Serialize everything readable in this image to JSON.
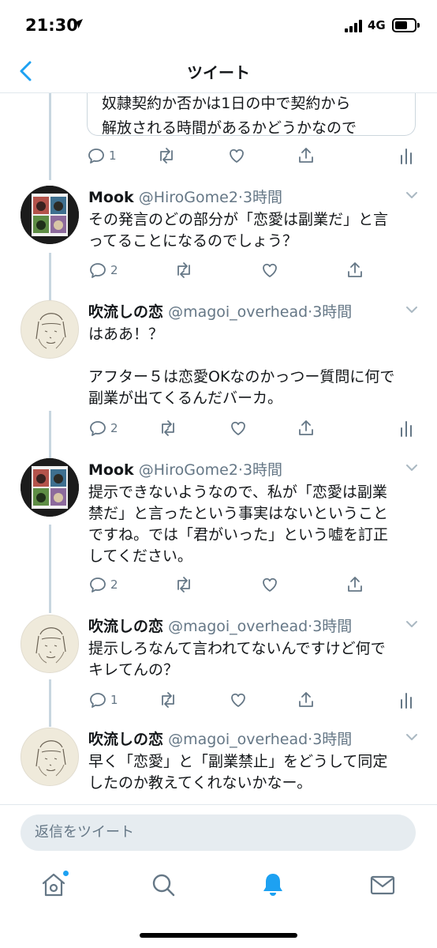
{
  "status_bar": {
    "time": "21:30",
    "network": "4G"
  },
  "nav": {
    "title": "ツイート"
  },
  "quoted_tweet": {
    "text": "奴隷契約か否かは1日の中で契約から\n解放される時間があるかどうかなので"
  },
  "first_actions": {
    "reply_count": "1"
  },
  "tweets": [
    {
      "name": "Mook",
      "handle": "@HiroGome2",
      "time": "·3時間",
      "text": "その発言のどの部分が「恋愛は副業だ」と言\nってることになるのでしょう？",
      "reply_count": "2"
    },
    {
      "name": "吹流しの恋",
      "handle": "@magoi_overhead",
      "time": "·3時間",
      "text": "はああ！？\n\nアフター５は恋愛OKなのかっつー質問に何で\n副業が出てくるんだバーカ。",
      "reply_count": "2"
    },
    {
      "name": "Mook",
      "handle": "@HiroGome2",
      "time": "·3時間",
      "text": "提示できないようなので、私が「恋愛は副業\n禁だ」と言ったという事実はないということ\nですね。では「君がいった」という嘘を訂正\nしてください。",
      "reply_count": "2"
    },
    {
      "name": "吹流しの恋",
      "handle": "@magoi_overhead",
      "time": "·3時間",
      "text": "提示しろなんて言われてないんですけど何で\nキレてんの？",
      "reply_count": "1"
    },
    {
      "name": "吹流しの恋",
      "handle": "@magoi_overhead",
      "time": "·3時間",
      "text": "早く「恋愛」と「副業禁止」をどうして同定\nしたのか教えてくれないかなー。",
      "reply_count": ""
    }
  ],
  "reply_bar": {
    "placeholder": "返信をツイート"
  },
  "icons": {
    "back": "chevron-left-icon",
    "reply": "reply-icon",
    "retweet": "retweet-icon",
    "like": "heart-icon",
    "share": "share-icon",
    "analytics": "analytics-icon",
    "caret": "chevron-down-icon",
    "home": "home-icon",
    "search": "search-icon",
    "notifications": "bell-icon",
    "messages": "mail-icon"
  },
  "colors": {
    "accent": "#1da1f2",
    "muted": "#657786",
    "thread_line": "#c8d6e0"
  }
}
